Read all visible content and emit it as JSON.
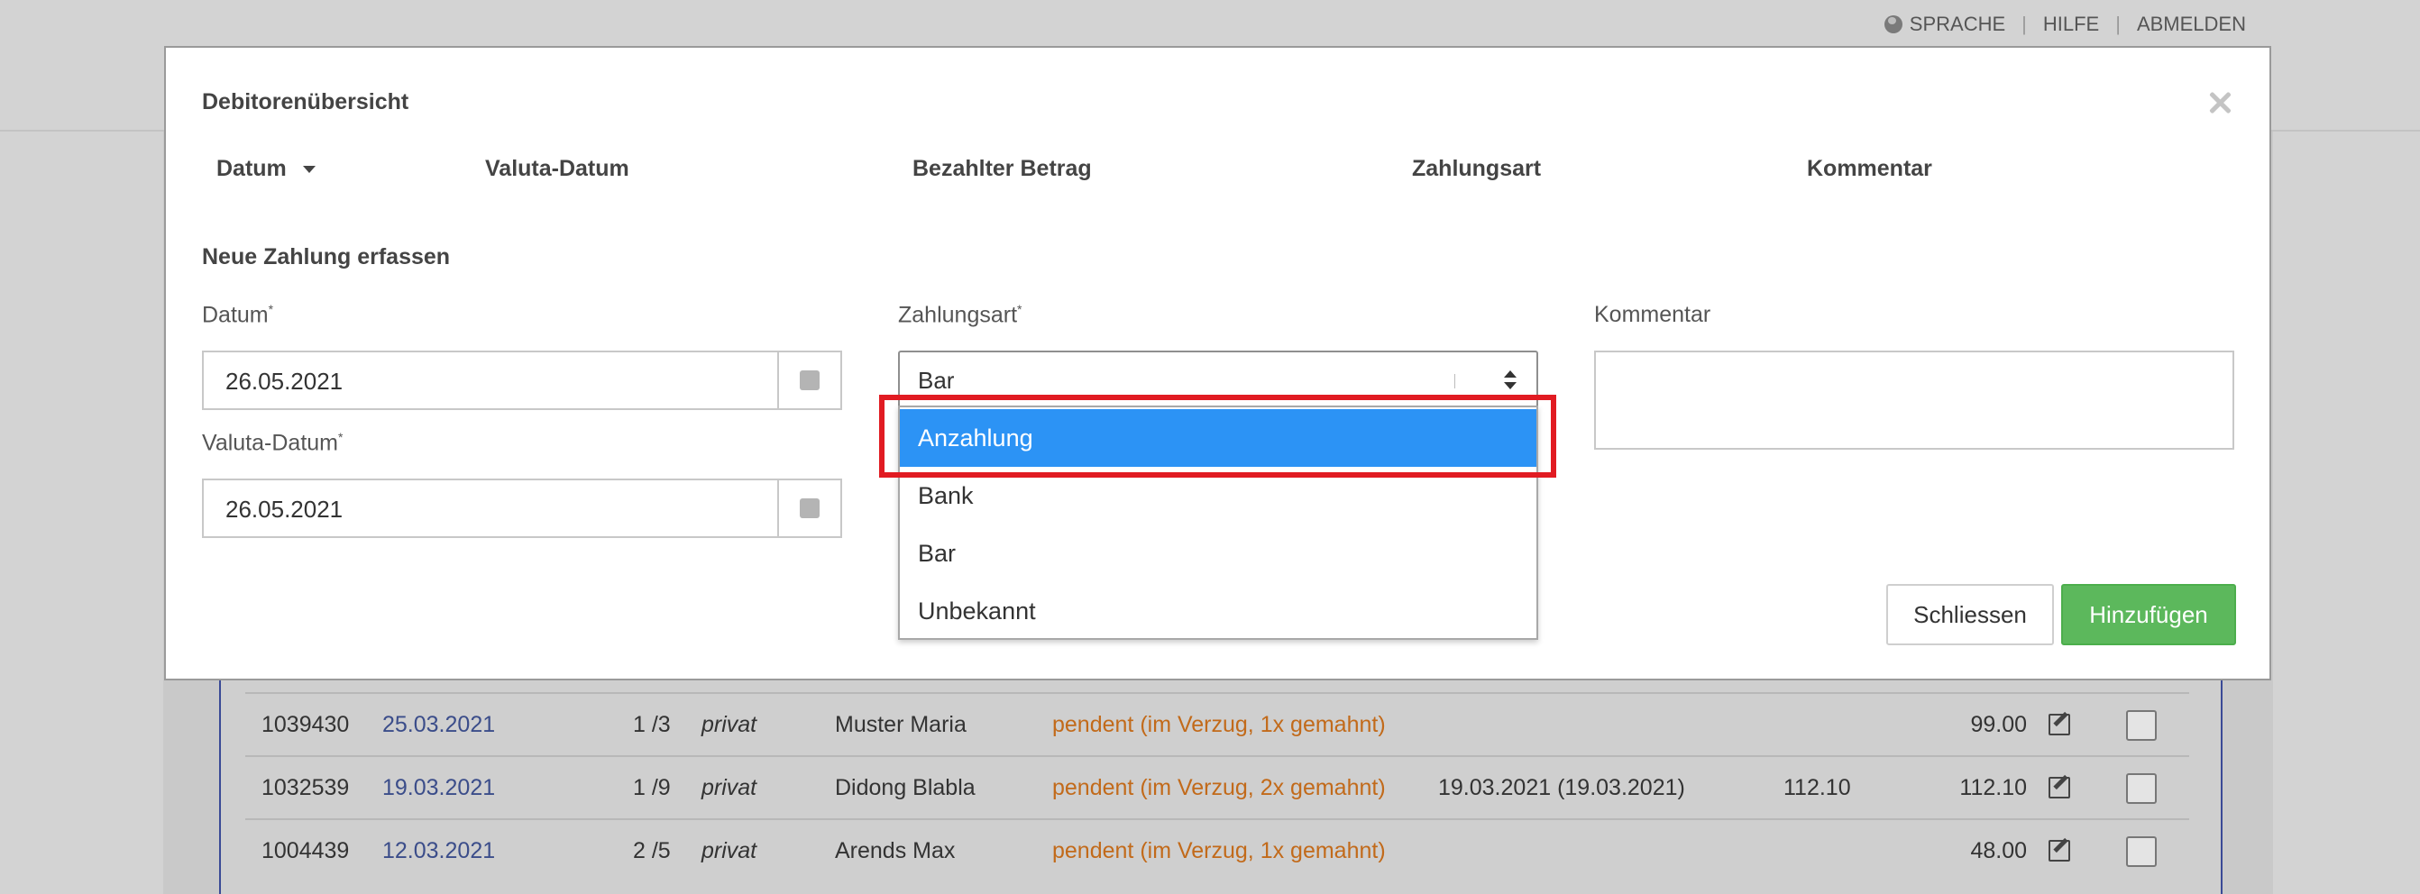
{
  "topnav": {
    "language": "SPRACHE",
    "help": "HILFE",
    "logout": "ABMELDEN",
    "separator": "|"
  },
  "modal": {
    "title": "Debitorenübersicht",
    "columns": [
      "Datum",
      "Valuta-Datum",
      "Bezahlter Betrag",
      "Zahlungsart",
      "Kommentar"
    ],
    "section_title": "Neue Zahlung erfassen",
    "datum_label": "Datum",
    "datum_value": "26.05.2021",
    "valuta_label": "Valuta-Datum",
    "valuta_value": "26.05.2021",
    "zahlungsart_label": "Zahlungsart",
    "zahlungsart_value": "Bar",
    "kommentar_label": "Kommentar",
    "required_mark": "*",
    "close_button": "Schliessen",
    "add_button": "Hinzufügen"
  },
  "dropdown": {
    "options": [
      "Anzahlung",
      "Bank",
      "Bar",
      "Unbekannt"
    ],
    "highlighted": "Anzahlung"
  },
  "table": {
    "rows": [
      {
        "id": "1039430",
        "date": "25.03.2021",
        "part": "1 /3",
        "type": "privat",
        "name": "Muster Maria",
        "status": "pendent (im Verzug, 1x gemahnt)",
        "paid_date": "",
        "paid": "",
        "amount": "99.00"
      },
      {
        "id": "1032539",
        "date": "19.03.2021",
        "part": "1 /9",
        "type": "privat",
        "name": "Didong Blabla",
        "status": "pendent (im Verzug, 2x gemahnt)",
        "paid_date": "19.03.2021 (19.03.2021)",
        "paid": "112.10",
        "amount": "112.10"
      },
      {
        "id": "1004439",
        "date": "12.03.2021",
        "part": "2 /5",
        "type": "privat",
        "name": "Arends Max",
        "status": "pendent (im Verzug, 1x gemahnt)",
        "paid_date": "",
        "paid": "",
        "amount": "48.00"
      }
    ]
  },
  "colors": {
    "accent_green": "#5cb85c",
    "selection_blue": "#2c93f5",
    "highlight_red": "#e11b22",
    "status_orange": "#c26a1a",
    "link_blue": "#3b4d8a"
  }
}
